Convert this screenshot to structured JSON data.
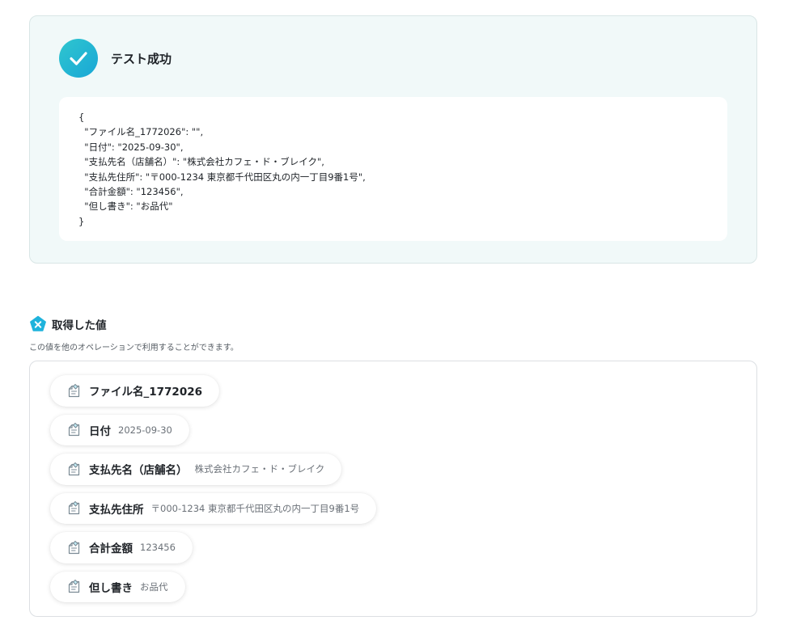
{
  "result": {
    "status_title": "テスト成功",
    "json_lines": [
      "{",
      "  \"ファイル名_1772026\": \"\",",
      "  \"日付\": \"2025-09-30\",",
      "  \"支払先名（店舗名）\": \"株式会社カフェ・ド・ブレイク\",",
      "  \"支払先住所\": \"〒000-1234 東京都千代田区丸の内一丁目9番1号\",",
      "  \"合計金額\": \"123456\",",
      "  \"但し書き\": \"お品代\"",
      "}"
    ]
  },
  "values": {
    "title": "取得した値",
    "description": "この値を他のオペレーションで利用することができます。",
    "items": [
      {
        "label": "ファイル名_1772026",
        "value": ""
      },
      {
        "label": "日付",
        "value": "2025-09-30"
      },
      {
        "label": "支払先名（店舗名）",
        "value": "株式会社カフェ・ド・ブレイク"
      },
      {
        "label": "支払先住所",
        "value": "〒000-1234 東京都千代田区丸の内一丁目9番1号"
      },
      {
        "label": "合計金額",
        "value": "123456"
      },
      {
        "label": "但し書き",
        "value": "お品代"
      }
    ]
  },
  "icons": {
    "status": "check-icon",
    "section": "variable-x-icon",
    "chip": "variable-tag-icon"
  },
  "colors": {
    "accent": "#19a7d6",
    "panel_bg": "#f1f9f9"
  }
}
